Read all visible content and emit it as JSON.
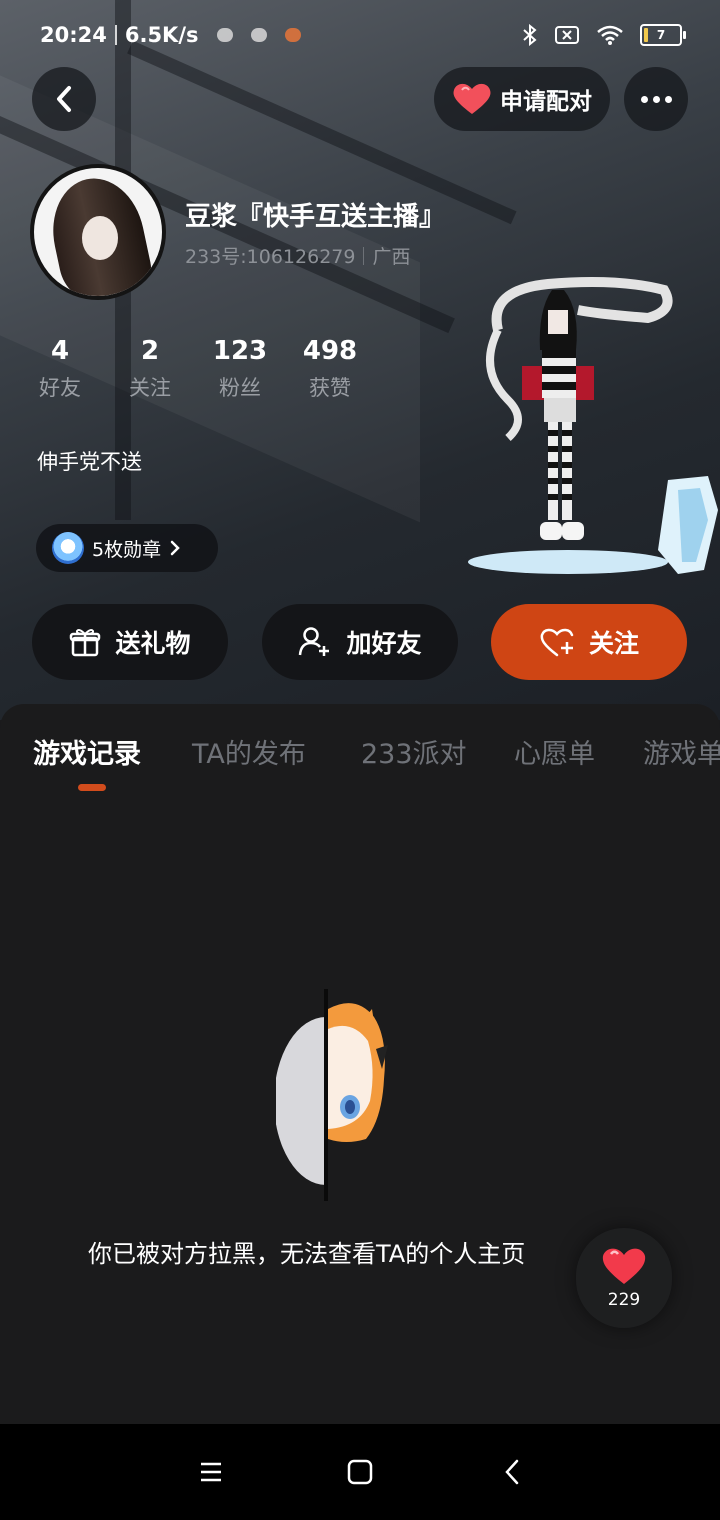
{
  "status_bar": {
    "time": "20:24",
    "speed": "6.5K/s",
    "battery": "7"
  },
  "header": {
    "pair_label": "申请配对"
  },
  "profile": {
    "username": "豆浆『快手互送主播』",
    "uid": "233号:106126279",
    "region": "广西",
    "stats": [
      {
        "value": "4",
        "label": "好友"
      },
      {
        "value": "2",
        "label": "关注"
      },
      {
        "value": "123",
        "label": "粉丝"
      },
      {
        "value": "498",
        "label": "获赞"
      }
    ],
    "bio": "伸手党不送",
    "badges_label": "5枚勋章"
  },
  "actions": {
    "gift": "送礼物",
    "add_friend": "加好友",
    "follow": "关注"
  },
  "tabs": [
    {
      "label": "游戏记录",
      "active": true
    },
    {
      "label": "TA的发布",
      "active": false
    },
    {
      "label": "233派对",
      "active": false
    },
    {
      "label": "心愿单",
      "active": false
    },
    {
      "label": "游戏单",
      "active": false
    }
  ],
  "empty_state": {
    "message": "你已被对方拉黑，无法查看TA的个人主页"
  },
  "floating_like": {
    "count": "229"
  },
  "colors": {
    "accent": "#cf4514",
    "background": "#1b1b1c",
    "heart": "#f2505b"
  },
  "icons": [
    "back-icon",
    "heart-icon",
    "more-icon",
    "gift-icon",
    "add-user-icon",
    "heart-plus-icon",
    "bluetooth-icon",
    "sim-icon",
    "wifi-icon",
    "battery-icon",
    "menu-icon",
    "home-icon",
    "nav-back-icon"
  ]
}
